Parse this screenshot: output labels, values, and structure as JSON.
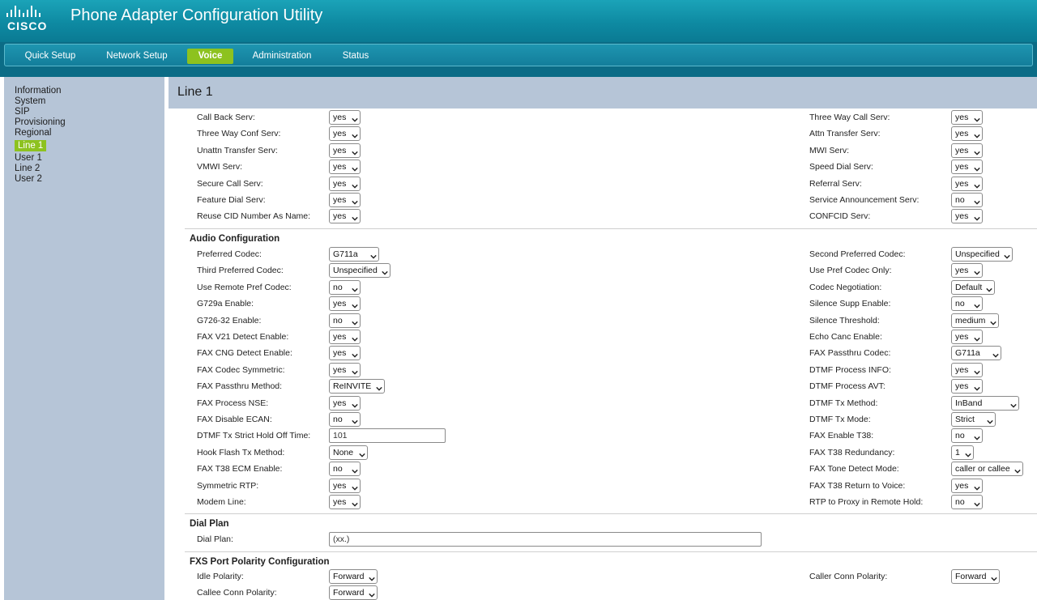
{
  "header": {
    "title": "Phone Adapter Configuration Utility",
    "logo_text": "CISCO"
  },
  "nav": {
    "tabs": [
      "Quick Setup",
      "Network Setup",
      "Voice",
      "Administration",
      "Status"
    ],
    "active": "Voice"
  },
  "sidebar": {
    "items": [
      "Information",
      "System",
      "SIP",
      "Provisioning",
      "Regional",
      "Line 1",
      "User 1",
      "Line 2",
      "User 2"
    ],
    "active": "Line 1"
  },
  "page": {
    "title": "Line 1"
  },
  "services": {
    "left": [
      {
        "label": "Call Back Serv:",
        "value": "yes"
      },
      {
        "label": "Three Way Conf Serv:",
        "value": "yes"
      },
      {
        "label": "Unattn Transfer Serv:",
        "value": "yes"
      },
      {
        "label": "VMWI Serv:",
        "value": "yes"
      },
      {
        "label": "Secure Call Serv:",
        "value": "yes"
      },
      {
        "label": "Feature Dial Serv:",
        "value": "yes"
      },
      {
        "label": "Reuse CID Number As Name:",
        "value": "yes"
      }
    ],
    "right": [
      {
        "label": "Three Way Call Serv:",
        "value": "yes"
      },
      {
        "label": "Attn Transfer Serv:",
        "value": "yes"
      },
      {
        "label": "MWI Serv:",
        "value": "yes"
      },
      {
        "label": "Speed Dial Serv:",
        "value": "yes"
      },
      {
        "label": "Referral Serv:",
        "value": "yes"
      },
      {
        "label": "Service Announcement Serv:",
        "value": "no"
      },
      {
        "label": "CONFCID Serv:",
        "value": "yes"
      }
    ]
  },
  "audio": {
    "heading": "Audio Configuration",
    "left": [
      {
        "label": "Preferred Codec:",
        "value": "G711a"
      },
      {
        "label": "Third Preferred Codec:",
        "value": "Unspecified"
      },
      {
        "label": "Use Remote Pref Codec:",
        "value": "no"
      },
      {
        "label": "G729a Enable:",
        "value": "yes"
      },
      {
        "label": "G726-32 Enable:",
        "value": "no"
      },
      {
        "label": "FAX V21 Detect Enable:",
        "value": "yes"
      },
      {
        "label": "FAX CNG Detect Enable:",
        "value": "yes"
      },
      {
        "label": "FAX Codec Symmetric:",
        "value": "yes"
      },
      {
        "label": "FAX Passthru Method:",
        "value": "ReINVITE"
      },
      {
        "label": "FAX Process NSE:",
        "value": "yes"
      },
      {
        "label": "FAX Disable ECAN:",
        "value": "no"
      },
      {
        "label": "DTMF Tx Strict Hold Off Time:",
        "value": "101"
      },
      {
        "label": "Hook Flash Tx Method:",
        "value": "None"
      },
      {
        "label": "FAX T38 ECM Enable:",
        "value": "no"
      },
      {
        "label": "Symmetric RTP:",
        "value": "yes"
      },
      {
        "label": "Modem Line:",
        "value": "yes"
      }
    ],
    "right": [
      {
        "label": "Second Preferred Codec:",
        "value": "Unspecified"
      },
      {
        "label": "Use Pref Codec Only:",
        "value": "yes"
      },
      {
        "label": "Codec Negotiation:",
        "value": "Default"
      },
      {
        "label": "Silence Supp Enable:",
        "value": "no"
      },
      {
        "label": "Silence Threshold:",
        "value": "medium"
      },
      {
        "label": "Echo Canc Enable:",
        "value": "yes"
      },
      {
        "label": "FAX Passthru Codec:",
        "value": "G711a"
      },
      {
        "label": "DTMF Process INFO:",
        "value": "yes"
      },
      {
        "label": "DTMF Process AVT:",
        "value": "yes"
      },
      {
        "label": "DTMF Tx Method:",
        "value": "InBand"
      },
      {
        "label": "DTMF Tx Mode:",
        "value": "Strict"
      },
      {
        "label": "FAX Enable T38:",
        "value": "no"
      },
      {
        "label": "FAX T38 Redundancy:",
        "value": "1"
      },
      {
        "label": "FAX Tone Detect Mode:",
        "value": "caller or callee"
      },
      {
        "label": "FAX T38 Return to Voice:",
        "value": "yes"
      },
      {
        "label": "RTP to Proxy in Remote Hold:",
        "value": "no"
      }
    ]
  },
  "dialplan": {
    "heading": "Dial Plan",
    "label": "Dial Plan:",
    "value": "(xx.)"
  },
  "fxs": {
    "heading": "FXS Port Polarity Configuration",
    "left": [
      {
        "label": "Idle Polarity:",
        "value": "Forward"
      },
      {
        "label": "Callee Conn Polarity:",
        "value": "Forward"
      }
    ],
    "right": [
      {
        "label": "Caller Conn Polarity:",
        "value": "Forward"
      }
    ]
  }
}
